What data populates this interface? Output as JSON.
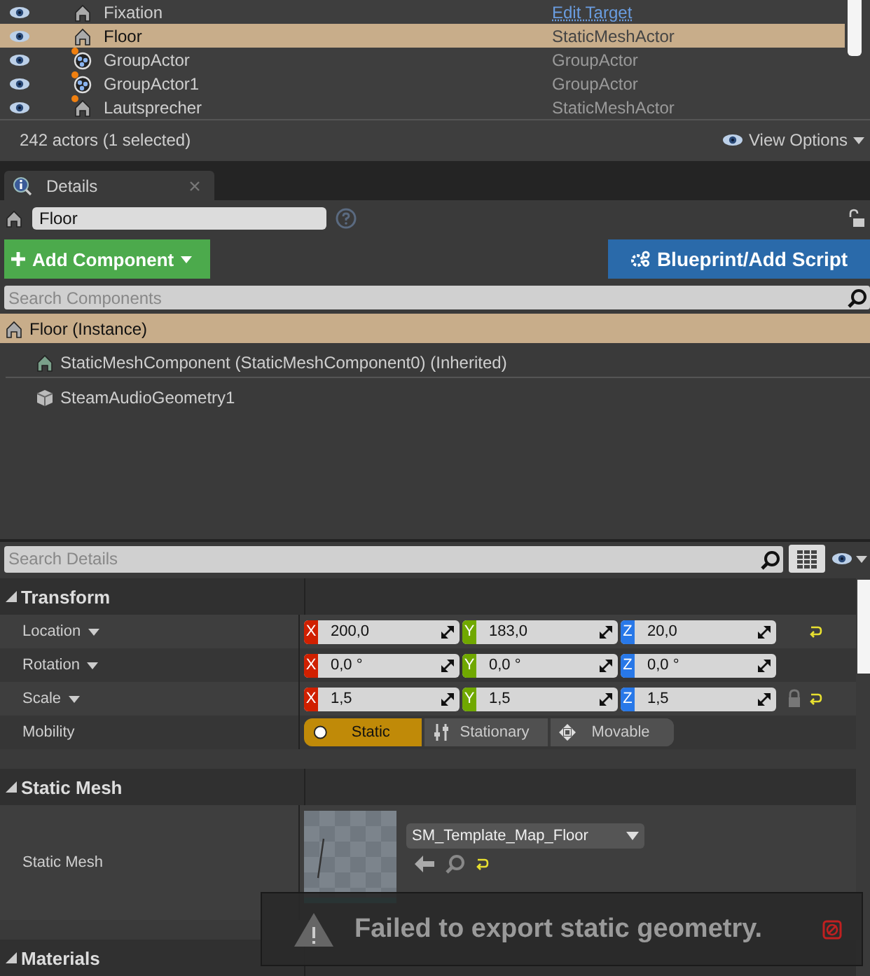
{
  "outliner": {
    "rows": [
      {
        "name": "Fixation",
        "type": "Edit Target",
        "type_is_link": true,
        "kind": "actor",
        "marker": false,
        "selected": false
      },
      {
        "name": "Floor",
        "type": "StaticMeshActor",
        "type_is_link": false,
        "kind": "mesh",
        "marker": false,
        "selected": true
      },
      {
        "name": "GroupActor",
        "type": "GroupActor",
        "type_is_link": false,
        "kind": "group",
        "marker": true,
        "selected": false
      },
      {
        "name": "GroupActor1",
        "type": "GroupActor",
        "type_is_link": false,
        "kind": "group",
        "marker": true,
        "selected": false
      },
      {
        "name": "Lautsprecher",
        "type": "StaticMeshActor",
        "type_is_link": false,
        "kind": "mesh",
        "marker": true,
        "selected": false
      }
    ],
    "status": "242 actors (1 selected)",
    "view_options": "View Options"
  },
  "details": {
    "tab": "Details",
    "object_name": "Floor",
    "add_component": "Add Component",
    "blueprint": "Blueprint/Add Script",
    "search_components": {
      "placeholder": "Search Components"
    },
    "components": [
      {
        "label": "Floor (Instance)",
        "kind": "actor",
        "selected": true,
        "children": [
          {
            "label": "StaticMeshComponent (StaticMeshComponent0) (Inherited)",
            "kind": "mesh",
            "selected": false
          },
          {
            "label": "SteamAudioGeometry1",
            "kind": "cube",
            "selected": false
          }
        ]
      }
    ],
    "search_details": {
      "placeholder": "Search Details"
    },
    "sections": [
      {
        "title": "Transform",
        "expanded": true,
        "properties": [
          {
            "kind": "vector",
            "label": "Location",
            "values": [
              {
                "axis": "X",
                "value": "200,0"
              },
              {
                "axis": "Y",
                "value": "183,0"
              },
              {
                "axis": "Z",
                "value": "20,0"
              }
            ],
            "lock": false,
            "reset": true
          },
          {
            "kind": "vector",
            "label": "Rotation",
            "values": [
              {
                "axis": "X",
                "value": "0,0 °"
              },
              {
                "axis": "Y",
                "value": "0,0 °"
              },
              {
                "axis": "Z",
                "value": "0,0 °"
              }
            ],
            "lock": false,
            "reset": false
          },
          {
            "kind": "vector",
            "label": "Scale",
            "values": [
              {
                "axis": "X",
                "value": "1,5"
              },
              {
                "axis": "Y",
                "value": "1,5"
              },
              {
                "axis": "Z",
                "value": "1,5"
              }
            ],
            "lock": true,
            "reset": true
          },
          {
            "kind": "mobility",
            "label": "Mobility",
            "options": [
              {
                "label": "Static",
                "selected": true
              },
              {
                "label": "Stationary",
                "selected": false
              },
              {
                "label": "Movable",
                "selected": false
              }
            ]
          }
        ]
      },
      {
        "title": "Static Mesh",
        "expanded": true,
        "properties": [
          {
            "kind": "asset",
            "label": "Static Mesh",
            "asset": "SM_Template_Map_Floor"
          }
        ]
      },
      {
        "title": "Materials",
        "expanded": true
      }
    ]
  },
  "toast": {
    "message": "Failed to export static geometry."
  }
}
